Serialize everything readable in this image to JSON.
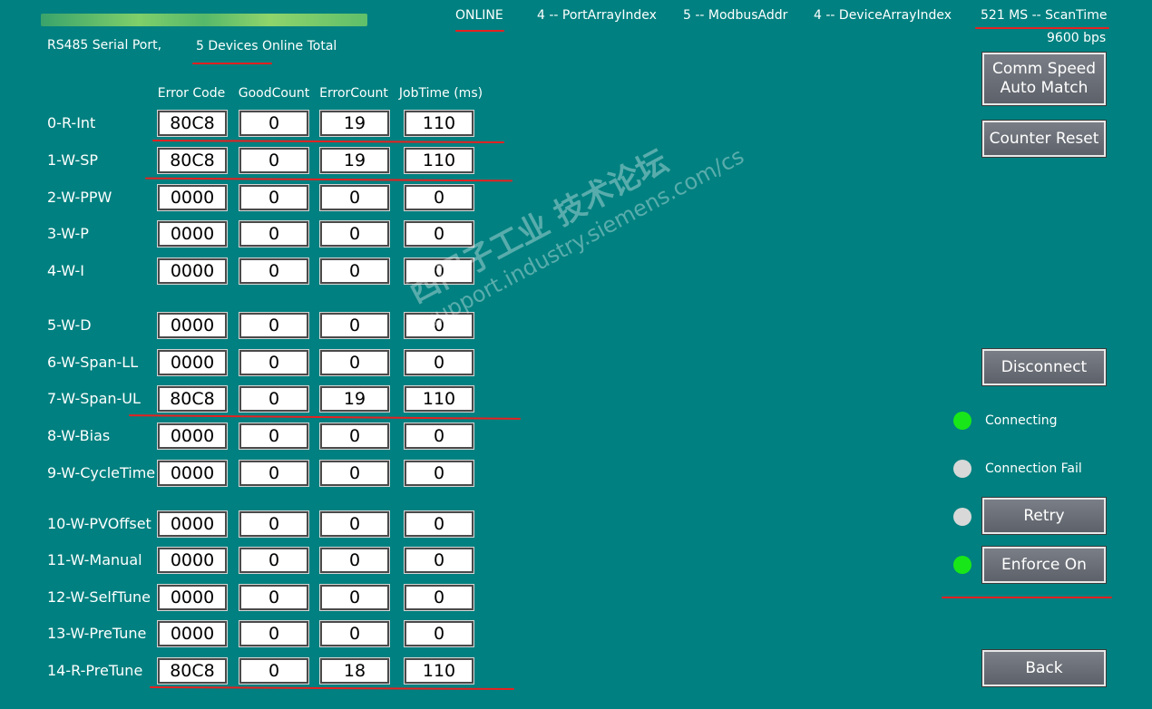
{
  "header": {
    "port_text": "RS485 Serial Port,",
    "devices_online": "5 Devices Online Total",
    "status": "ONLINE",
    "port_array_index": "4 -- PortArrayIndex",
    "modbus_addr": "5 -- ModbusAddr",
    "device_array_index": "4 -- DeviceArrayIndex",
    "scan_time": "521 MS -- ScanTime",
    "baud": "9600 bps"
  },
  "columns": [
    "Error Code",
    "GoodCount",
    "ErrorCount",
    "JobTime (ms)"
  ],
  "rows": [
    {
      "label": "0-R-Int",
      "values": [
        "80C8",
        "0",
        "19",
        "110"
      ]
    },
    {
      "label": "1-W-SP",
      "values": [
        "80C8",
        "0",
        "19",
        "110"
      ]
    },
    {
      "label": "2-W-PPW",
      "values": [
        "0000",
        "0",
        "0",
        "0"
      ]
    },
    {
      "label": "3-W-P",
      "values": [
        "0000",
        "0",
        "0",
        "0"
      ]
    },
    {
      "label": "4-W-I",
      "values": [
        "0000",
        "0",
        "0",
        "0"
      ]
    },
    {
      "label": "5-W-D",
      "values": [
        "0000",
        "0",
        "0",
        "0"
      ]
    },
    {
      "label": "6-W-Span-LL",
      "values": [
        "0000",
        "0",
        "0",
        "0"
      ]
    },
    {
      "label": "7-W-Span-UL",
      "values": [
        "80C8",
        "0",
        "19",
        "110"
      ]
    },
    {
      "label": "8-W-Bias",
      "values": [
        "0000",
        "0",
        "0",
        "0"
      ]
    },
    {
      "label": "9-W-CycleTime",
      "values": [
        "0000",
        "0",
        "0",
        "0"
      ]
    },
    {
      "label": "10-W-PVOffset",
      "values": [
        "0000",
        "0",
        "0",
        "0"
      ]
    },
    {
      "label": "11-W-Manual",
      "values": [
        "0000",
        "0",
        "0",
        "0"
      ]
    },
    {
      "label": "12-W-SelfTune",
      "values": [
        "0000",
        "0",
        "0",
        "0"
      ]
    },
    {
      "label": "13-W-PreTune",
      "values": [
        "0000",
        "0",
        "0",
        "0"
      ]
    },
    {
      "label": "14-R-PreTune",
      "values": [
        "80C8",
        "0",
        "18",
        "110"
      ]
    }
  ],
  "buttons": {
    "comm_speed": "Comm Speed\nAuto Match",
    "counter_reset": "Counter Reset",
    "disconnect": "Disconnect",
    "retry": "Retry",
    "enforce_on": "Enforce On",
    "back": "Back"
  },
  "indicators": {
    "connecting": {
      "label": "Connecting",
      "state": "on"
    },
    "connection_fail": {
      "label": "Connection Fail",
      "state": "off"
    },
    "retry": {
      "state": "off"
    },
    "enforce": {
      "state": "on"
    }
  },
  "watermark": {
    "line1": "西门子工业 技术论坛",
    "line2": "support.industry.siemens.com/cs"
  },
  "colors": {
    "background": "#008080",
    "lamp_on": "#19e619",
    "lamp_off": "#d8d8d8",
    "annotation": "#e82020"
  }
}
